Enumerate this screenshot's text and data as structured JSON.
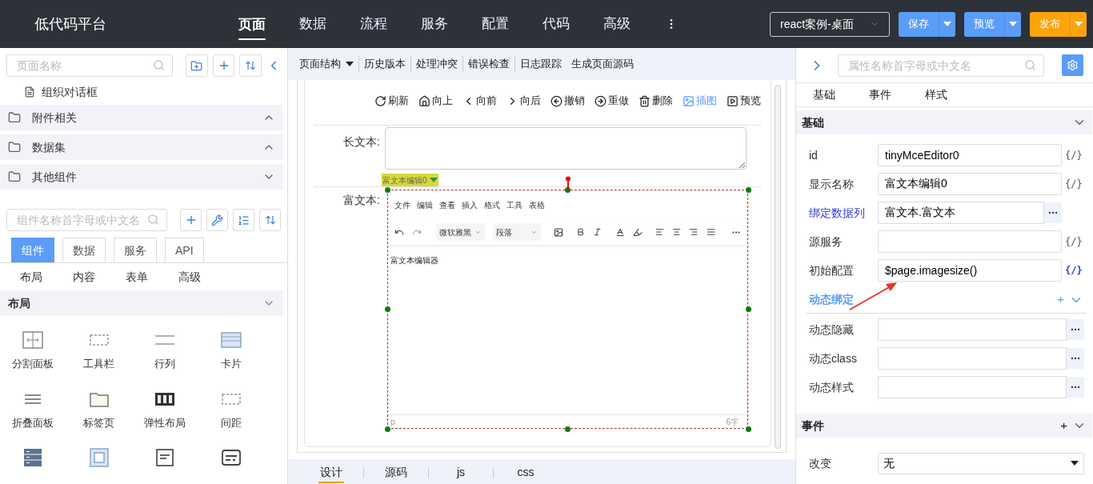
{
  "header": {
    "title": "低代码平台",
    "nav": [
      {
        "label": "页面",
        "selected": true
      },
      {
        "label": "数据",
        "selected": false
      },
      {
        "label": "流程",
        "selected": false
      },
      {
        "label": "服务",
        "selected": false
      },
      {
        "label": "配置",
        "selected": false
      },
      {
        "label": "代码",
        "selected": false
      },
      {
        "label": "高级",
        "selected": false
      }
    ],
    "project": "react案例-桌面",
    "actions": [
      {
        "label": "保存",
        "kind": "primary"
      },
      {
        "label": "预览",
        "kind": "primary"
      },
      {
        "label": "发布",
        "kind": "publish"
      }
    ]
  },
  "page_tree": {
    "search_placeholder": "页面名称",
    "item": "组织对话框",
    "groups": [
      {
        "label": "附件相关",
        "expanded": false
      },
      {
        "label": "数据集",
        "expanded": false
      },
      {
        "label": "其他组件",
        "expanded": true
      }
    ]
  },
  "components": {
    "search_placeholder": "组件名称首字母或中文名",
    "tabs": [
      {
        "label": "组件",
        "selected": true
      },
      {
        "label": "数据",
        "selected": false
      },
      {
        "label": "服务",
        "selected": false
      },
      {
        "label": "API",
        "selected": false
      }
    ],
    "subtabs": [
      "布局",
      "内容",
      "表单",
      "高级"
    ],
    "section": {
      "label": "布局",
      "expanded": true
    },
    "items": [
      {
        "kind": "split",
        "label": "分割面板"
      },
      {
        "kind": "toolbar",
        "label": "工具栏"
      },
      {
        "kind": "rowcol",
        "label": "行列"
      },
      {
        "kind": "card",
        "label": "卡片"
      },
      {
        "kind": "collapse",
        "label": "折叠面板"
      },
      {
        "kind": "tabs",
        "label": "标签页"
      },
      {
        "kind": "flex",
        "label": "弹性布局"
      },
      {
        "kind": "spacer",
        "label": "间距"
      },
      {
        "kind": "stack"
      },
      {
        "kind": "frame"
      },
      {
        "kind": "div"
      },
      {
        "kind": "form"
      }
    ]
  },
  "designer": {
    "toolbar": [
      {
        "label": "页面结构",
        "dropdown": true
      },
      {
        "label": "历史版本",
        "dropdown": false
      },
      {
        "label": "处理冲突",
        "dropdown": false
      },
      {
        "label": "错误检查",
        "dropdown": false
      },
      {
        "label": "日志跟踪",
        "dropdown": false
      },
      {
        "label": "生成页面源码",
        "dropdown": false
      }
    ],
    "actions": [
      {
        "kind": "refresh",
        "label": "刷新",
        "active": false
      },
      {
        "kind": "up",
        "label": "向上",
        "active": false
      },
      {
        "kind": "prev",
        "label": "向前",
        "active": false
      },
      {
        "kind": "next",
        "label": "向后",
        "active": false
      },
      {
        "kind": "undo",
        "label": "撤销",
        "active": false
      },
      {
        "kind": "redo",
        "label": "重做",
        "active": false
      },
      {
        "kind": "delete",
        "label": "删除",
        "active": false
      },
      {
        "kind": "image",
        "label": "插图",
        "active": true
      },
      {
        "kind": "preview",
        "label": "预览",
        "active": false
      }
    ],
    "long_text_label": "长文本:",
    "selection_tag": "富文本编辑0",
    "rich_text_label": "富文本:",
    "editor": {
      "menu": [
        "文件",
        "编辑",
        "查看",
        "插入",
        "格式",
        "工具",
        "表格"
      ],
      "font": "微软雅黑",
      "block": "段落",
      "content": "富文本编辑器",
      "path": "p",
      "word_count": "6字"
    },
    "tabs": [
      {
        "label": "设计",
        "selected": true
      },
      {
        "label": "源码",
        "selected": false
      },
      {
        "label": "js",
        "selected": false
      },
      {
        "label": "css",
        "selected": false
      }
    ]
  },
  "properties": {
    "search_placeholder": "属性名称首字母或中文名",
    "tabs": [
      "基础",
      "事件",
      "样式"
    ],
    "basic": {
      "label": "基础",
      "expanded": true
    },
    "fields": [
      {
        "label": "id",
        "value": "tinyMceEditor0",
        "kind": "code",
        "bound": false,
        "toggle": "{/}",
        "active": false
      },
      {
        "label": "显示名称",
        "value": "富文本编辑0",
        "kind": "code",
        "bound": false,
        "toggle": "{/}",
        "active": false
      },
      {
        "label": "绑定数据列",
        "value": "富文本.富文本",
        "kind": "picker",
        "bound": true
      },
      {
        "label": "源服务",
        "kind": "code",
        "bound": false,
        "toggle": "{/}",
        "active": false
      },
      {
        "label": "初始配置",
        "value": "$page.imagesize()",
        "kind": "code",
        "bound": false,
        "toggle": "{/}",
        "active": true
      }
    ],
    "dynamic": {
      "label": "动态绑定",
      "add": "+",
      "expanded": true,
      "fields": [
        {
          "label": "动态隐藏"
        },
        {
          "label": "动态class"
        },
        {
          "label": "动态样式"
        }
      ]
    },
    "events": {
      "label": "事件",
      "add": "+",
      "expanded": true,
      "fields": [
        {
          "label": "改变",
          "value": "无"
        }
      ]
    }
  }
}
